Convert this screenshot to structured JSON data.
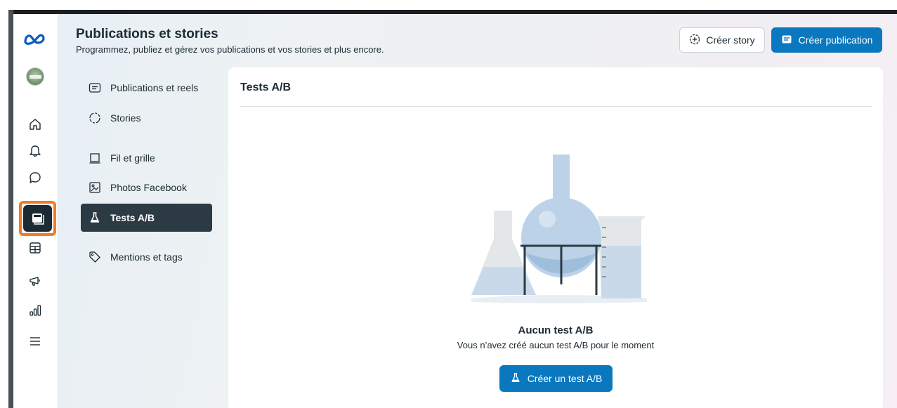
{
  "app": {
    "brand_icon": "meta-logo-icon",
    "page_title": "Publications et stories",
    "page_subtitle": "Programmez, publiez et gérez vos publications et vos stories et plus encore."
  },
  "header_actions": {
    "create_story_label": "Créer story",
    "create_post_label": "Créer publication",
    "accent_color": "#0a78be"
  },
  "rail": {
    "items": [
      {
        "icon": "home-icon"
      },
      {
        "icon": "bell-icon"
      },
      {
        "icon": "chat-bubble-icon"
      },
      {
        "icon": "content-icon",
        "active": true
      },
      {
        "icon": "table-icon"
      },
      {
        "icon": "megaphone-icon"
      },
      {
        "icon": "bar-chart-icon"
      },
      {
        "icon": "menu-icon"
      }
    ],
    "highlight_color": "#f47a24"
  },
  "nav": {
    "items": [
      {
        "label": "Publications et reels",
        "icon": "post-lines-icon"
      },
      {
        "label": "Stories",
        "icon": "stories-circle-icon"
      },
      {
        "label": "Fil et grille",
        "icon": "grid-frame-icon"
      },
      {
        "label": "Photos Facebook",
        "icon": "photo-icon"
      },
      {
        "label": "Tests A/B",
        "icon": "flask-icon",
        "active": true
      },
      {
        "label": "Mentions et tags",
        "icon": "tag-icon"
      }
    ]
  },
  "panel": {
    "title": "Tests A/B",
    "empty_title": "Aucun test A/B",
    "empty_subtitle": "Vous n’avez créé aucun test A/B pour le moment",
    "create_button_label": "Créer un test A/B"
  }
}
